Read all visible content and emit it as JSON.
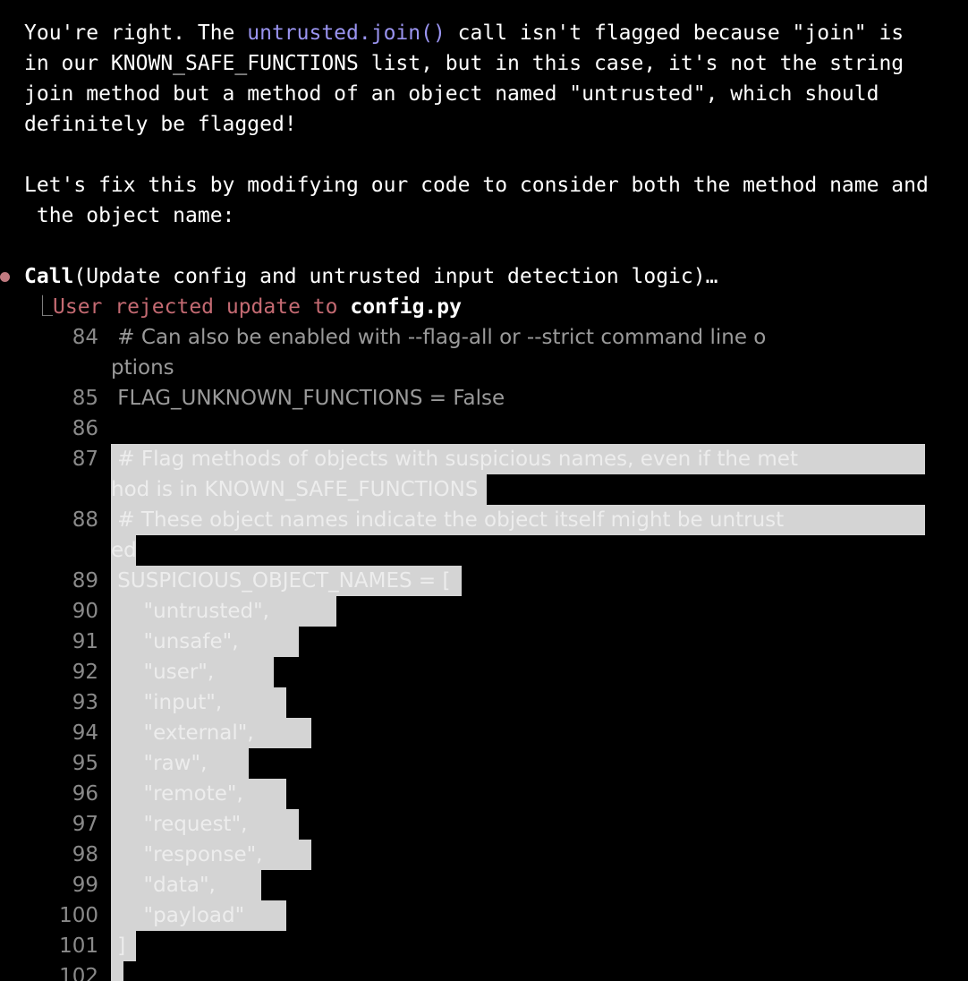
{
  "message": {
    "para1_line1_pre": "You're right. The ",
    "para1_line1_code": "untrusted.join()",
    "para1_line1_post": " call isn't flagged because \"join\" is",
    "para1_line2": "in our KNOWN_SAFE_FUNCTIONS list, but in this case, it's not the string",
    "para1_line3": "join method but a method of an object named \"untrusted\", which should",
    "para1_line4": "definitely be flagged!",
    "para2_line1": "Let's fix this by modifying our code to consider both the method name and",
    "para2_line2": " the object name:"
  },
  "tool_call": {
    "call_word": "Call",
    "call_args": "(Update config and untrusted input detection logic)…",
    "tree_char": "⎿",
    "rejected_text": "User rejected update to ",
    "file_name": "config.py"
  },
  "code": {
    "lines": [
      {
        "num": "84",
        "text": " # Can also be enabled with --flag-all or --strict command line o"
      },
      {
        "num": "",
        "text": "ptions"
      },
      {
        "num": "85",
        "text": " FLAG_UNKNOWN_FUNCTIONS = False"
      },
      {
        "num": "86",
        "text": ""
      },
      {
        "num": "87",
        "text": " # Flag methods of objects with suspicious names, even if the met"
      },
      {
        "num": "",
        "text": "hod is in KNOWN_SAFE_FUNCTIONS"
      },
      {
        "num": "88",
        "text": " # These object names indicate the object itself might be untrust"
      },
      {
        "num": "",
        "text": "ed"
      },
      {
        "num": "89",
        "text": " SUSPICIOUS_OBJECT_NAMES = ["
      },
      {
        "num": "90",
        "text": "     \"untrusted\","
      },
      {
        "num": "91",
        "text": "     \"unsafe\","
      },
      {
        "num": "92",
        "text": "     \"user\","
      },
      {
        "num": "93",
        "text": "     \"input\","
      },
      {
        "num": "94",
        "text": "     \"external\","
      },
      {
        "num": "95",
        "text": "     \"raw\","
      },
      {
        "num": "96",
        "text": "     \"remote\","
      },
      {
        "num": "97",
        "text": "     \"request\","
      },
      {
        "num": "98",
        "text": "     \"response\","
      },
      {
        "num": "99",
        "text": "     \"data\","
      },
      {
        "num": "100",
        "text": "     \"payload\""
      },
      {
        "num": "101",
        "text": " ]"
      },
      {
        "num": "102",
        "text": ""
      }
    ]
  },
  "colors": {
    "background": "#000000",
    "inline_code": "#9a94f0",
    "rejected": "#c46a72",
    "bullet": "#c07a80",
    "selection": "#d4d4d4",
    "line_number": "#8a8a8a"
  }
}
